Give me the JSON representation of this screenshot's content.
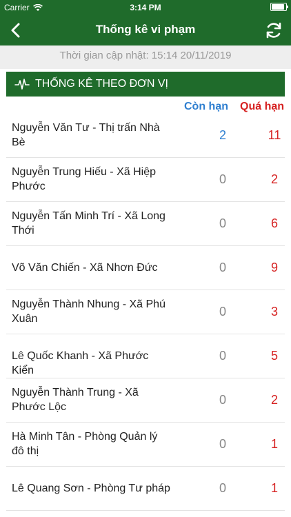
{
  "status_bar": {
    "carrier": "Carrier",
    "time": "3:14 PM"
  },
  "navbar": {
    "title": "Thống kê vi phạm"
  },
  "update_info": {
    "text": "Thời gian cập nhật: 15:14 20/11/2019"
  },
  "section": {
    "title": "THỐNG KÊ THEO ĐƠN VỊ",
    "col_con_han": "Còn hạn",
    "col_qua_han": "Quá hạn"
  },
  "rows": [
    {
      "name": "Nguyễn Văn  Tư - Thị trấn Nhà Bè",
      "con_han": "2",
      "qua_han": "11"
    },
    {
      "name": "Nguyễn Trung Hiếu - Xã Hiệp Phước",
      "con_han": "0",
      "qua_han": "2"
    },
    {
      "name": "Nguyễn Tấn Minh Trí - Xã Long Thới",
      "con_han": "0",
      "qua_han": "6"
    },
    {
      "name": "Võ Văn Chiến - Xã Nhơn Đức",
      "con_han": "0",
      "qua_han": "9"
    },
    {
      "name": "Nguyễn Thành Nhung - Xã Phú Xuân",
      "con_han": "0",
      "qua_han": "3"
    },
    {
      "name": "Lê Quốc Khanh - Xã Phước Kiển",
      "con_han": "0",
      "qua_han": "5"
    },
    {
      "name": "Nguyễn Thành Trung - Xã Phước Lộc",
      "con_han": "0",
      "qua_han": "2"
    },
    {
      "name": "Hà Minh  Tân - Phòng Quản lý đô thị",
      "con_han": "0",
      "qua_han": "1"
    },
    {
      "name": "Lê Quang Sơn - Phòng Tư pháp",
      "con_han": "0",
      "qua_han": "1"
    }
  ],
  "colors": {
    "header_green": "#1f6b2b",
    "con_han_blue": "#2f7fd0",
    "qua_han_red": "#d62222"
  },
  "icons": {
    "back": "chevron-left-icon",
    "refresh": "refresh-icon",
    "section": "pulse-icon"
  }
}
